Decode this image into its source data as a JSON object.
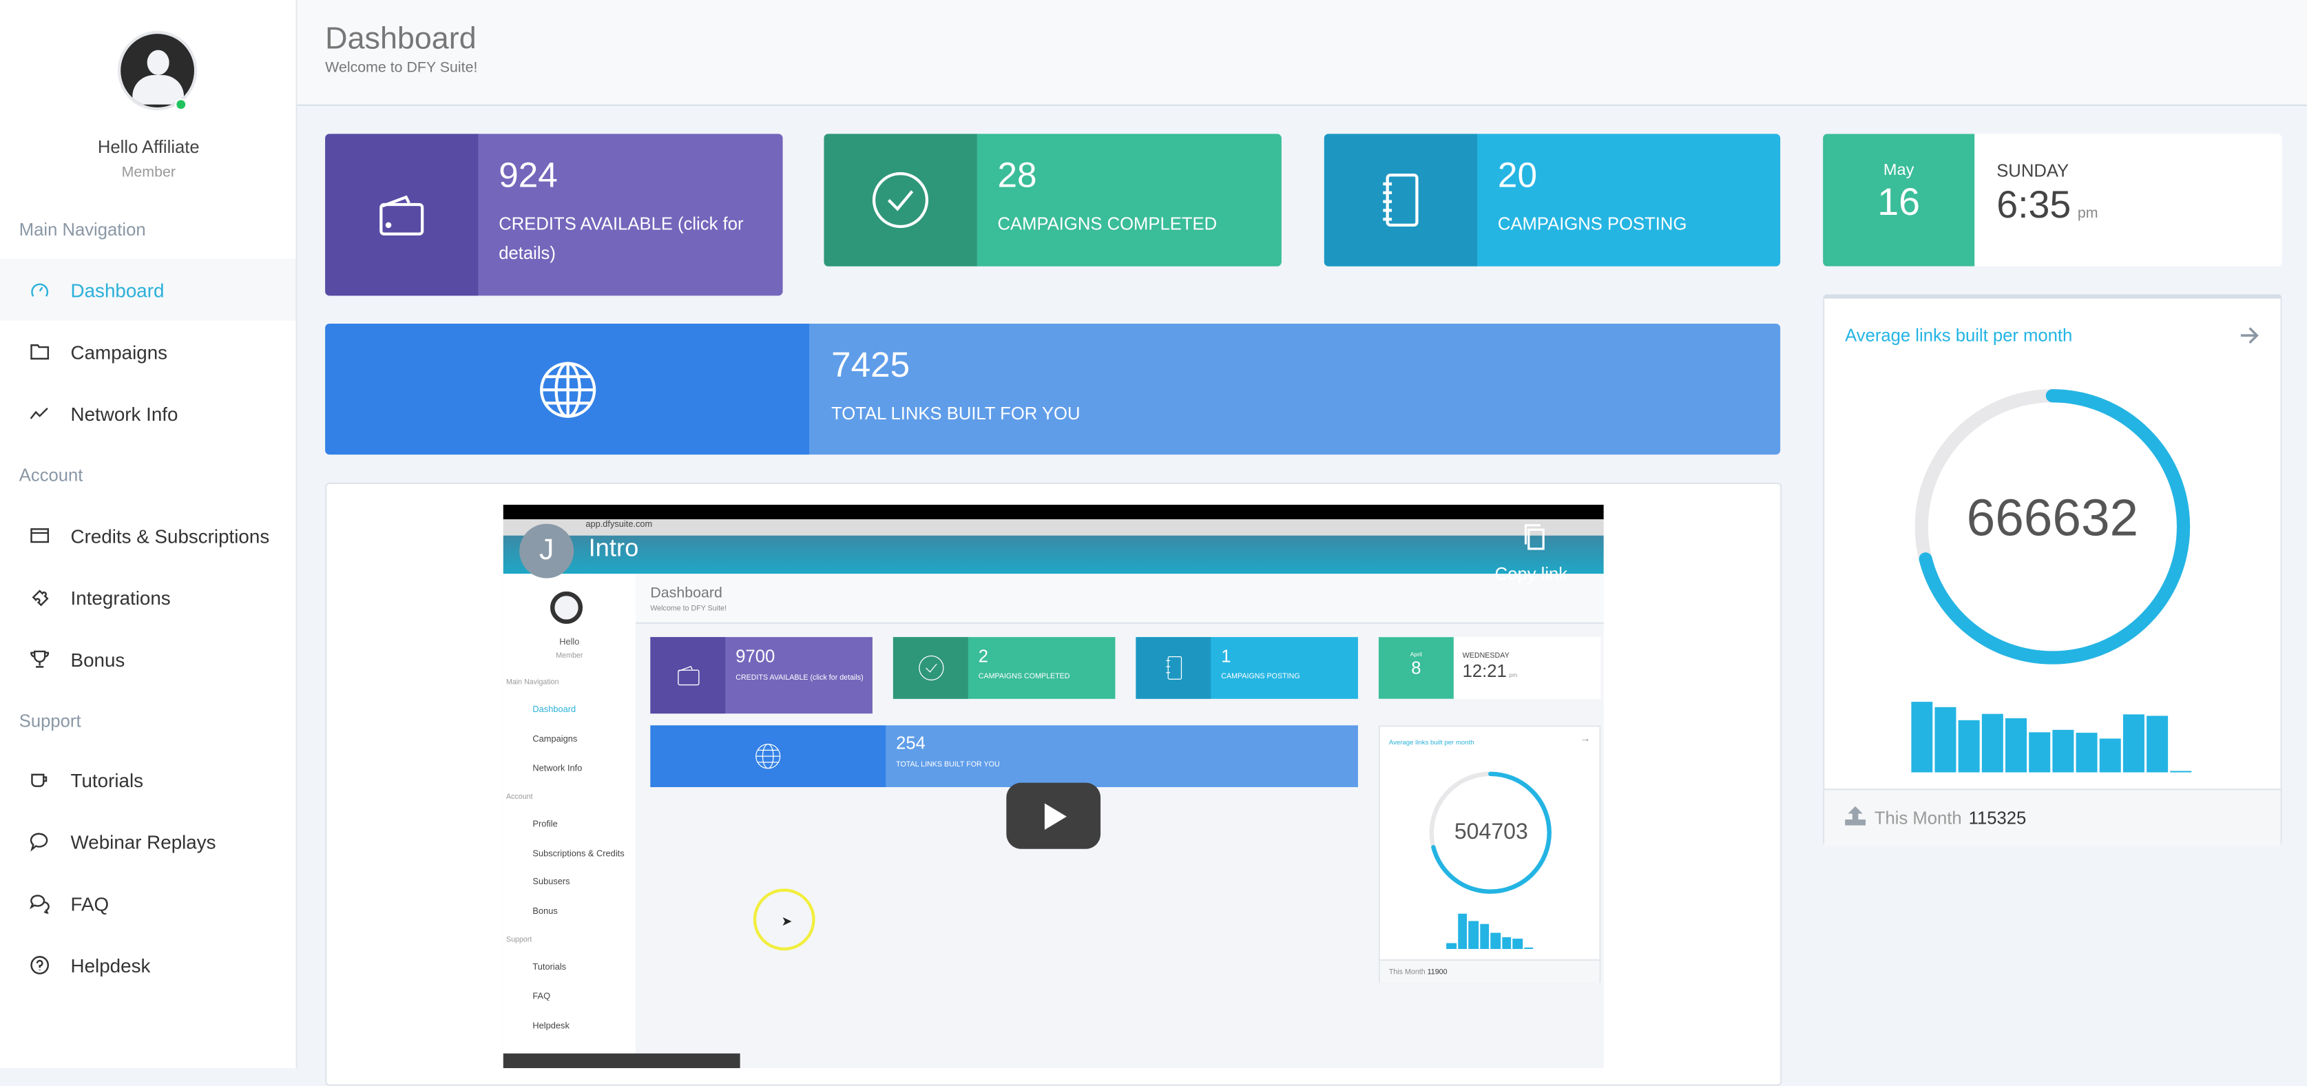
{
  "sidebar": {
    "user": {
      "greeting": "Hello Affiliate",
      "role": "Member",
      "status_color": "#22c35e"
    },
    "sections": [
      {
        "title": "Main Navigation",
        "items": [
          {
            "label": "Dashboard",
            "icon": "speedometer-icon",
            "active": true
          },
          {
            "label": "Campaigns",
            "icon": "folder-icon"
          },
          {
            "label": "Network Info",
            "icon": "trend-line-icon"
          }
        ]
      },
      {
        "title": "Account",
        "items": [
          {
            "label": "Credits & Subscriptions",
            "icon": "credit-card-icon"
          },
          {
            "label": "Integrations",
            "icon": "puzzle-icon"
          },
          {
            "label": "Bonus",
            "icon": "trophy-icon"
          }
        ]
      },
      {
        "title": "Support",
        "items": [
          {
            "label": "Tutorials",
            "icon": "cup-icon"
          },
          {
            "label": "Webinar Replays",
            "icon": "chat-bubble-icon"
          },
          {
            "label": "FAQ",
            "icon": "chat-bubbles-icon"
          },
          {
            "label": "Helpdesk",
            "icon": "question-circle-icon"
          }
        ]
      }
    ]
  },
  "header": {
    "title": "Dashboard",
    "subtitle": "Welcome to DFY Suite!"
  },
  "stats": [
    {
      "value": "924",
      "label": "CREDITS AVAILABLE (click for details)",
      "icon": "wallet-icon",
      "color": "#7466bb",
      "icon_bg": "#574ba4"
    },
    {
      "value": "28",
      "label": "CAMPAIGNS COMPLETED",
      "icon": "check-circle-icon",
      "color": "#3abd99",
      "icon_bg": "#2e9779"
    },
    {
      "value": "20",
      "label": "CAMPAIGNS POSTING",
      "icon": "notebook-icon",
      "color": "#25b5e3",
      "icon_bg": "#1d97c2"
    }
  ],
  "total_links": {
    "value": "7425",
    "label": "TOTAL LINKS BUILT FOR YOU",
    "icon": "globe-icon",
    "color": "#5f9de9",
    "icon_bg": "#3381e6"
  },
  "date": {
    "month": "May",
    "day": "16",
    "weekday": "SUNDAY",
    "time": "6:35",
    "ampm": "pm"
  },
  "avg_links": {
    "title": "Average links built per month",
    "value": "666632",
    "progress": 0.71,
    "monthly_bars": [
      146,
      135,
      108,
      121,
      112,
      83,
      88,
      82,
      70,
      120,
      117,
      2
    ],
    "footer_label": "This Month",
    "footer_value": "115325",
    "accent": "#23b4e3"
  },
  "video": {
    "channel_initial": "J",
    "title": "Intro",
    "copy_link": "Copy link",
    "url": "app.dfysuite.com",
    "mini": {
      "title": "Dashboard",
      "subtitle": "Welcome to DFY Suite!",
      "greeting": "Hello",
      "role": "Member",
      "sidebar": [
        "Main Navigation",
        "Dashboard",
        "Campaigns",
        "Network Info",
        "Account",
        "Profile",
        "Subscriptions & Credits",
        "Subusers",
        "Bonus",
        "Support",
        "Tutorials",
        "FAQ",
        "Helpdesk"
      ],
      "credits": "9700",
      "credits_label": "CREDITS AVAILABLE (click for details)",
      "completed": "2",
      "completed_label": "CAMPAIGNS COMPLETED",
      "posting": "1",
      "posting_label": "CAMPAIGNS POSTING",
      "month": "April",
      "day": "8",
      "weekday": "WEDNESDAY",
      "time": "12:21",
      "ampm": "pm",
      "total": "254",
      "total_label": "TOTAL LINKS BUILT FOR YOU",
      "avg_title": "Average links built per month",
      "avg_value": "504703",
      "avg_progress": 0.71,
      "bars": [
        15,
        90,
        70,
        62,
        40,
        30,
        25,
        3
      ],
      "footer_label": "This Month",
      "footer_value": "11900"
    }
  }
}
